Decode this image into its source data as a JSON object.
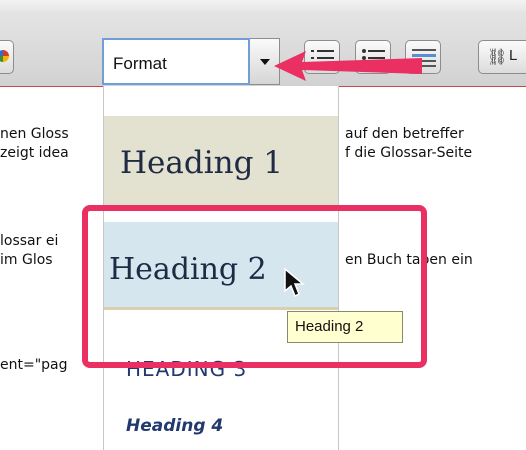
{
  "toolbar": {
    "format_select": {
      "value": "Format"
    },
    "link_button": {
      "label": "L"
    },
    "icons": [
      "palette-icon",
      "numbered-list-icon",
      "bullet-list-icon",
      "text-align-icon",
      "link-icon",
      "dropdown-arrow-icon"
    ]
  },
  "background_text": {
    "line1_left": "nen Gloss",
    "line1_right": "auf den betreffer",
    "line2_left": "zeigt idea",
    "line2_right": "f die Glossar-Seite",
    "line3_left": "lossar ei",
    "line4_left": "im Glos",
    "line4_right": "en Buch taben ein",
    "line5_left": "ent=\"pag"
  },
  "format_dropdown": {
    "items": [
      {
        "label": "Heading 1"
      },
      {
        "label": "Heading 2"
      },
      {
        "label": "HEADING 3"
      },
      {
        "label": "Heading 4"
      }
    ],
    "hovered_index": 1
  },
  "tooltip": {
    "text": "Heading 2"
  },
  "annotation": {
    "highlight_color": "#ea2f63",
    "arrow_color": "#ea2f63"
  }
}
